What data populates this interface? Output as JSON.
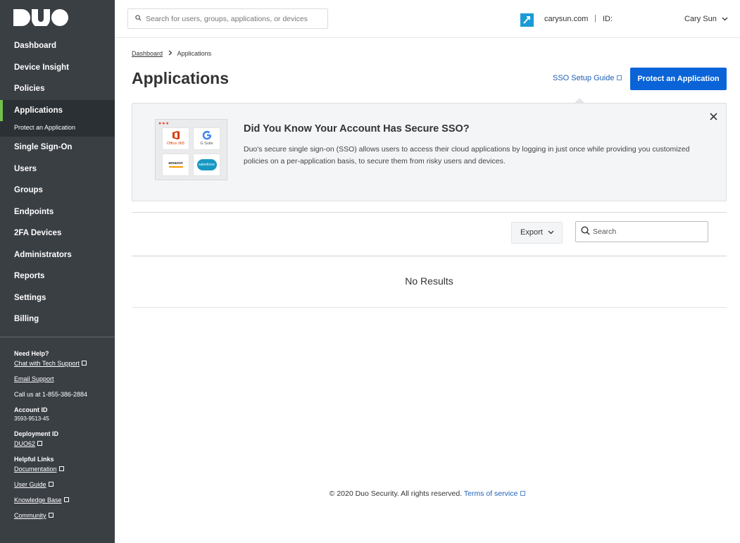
{
  "brand": {
    "logo": "DUO"
  },
  "sidebar": {
    "items": [
      {
        "label": "Dashboard"
      },
      {
        "label": "Device Insight"
      },
      {
        "label": "Policies"
      },
      {
        "label": "Applications"
      },
      {
        "label": "Single Sign-On"
      },
      {
        "label": "Users"
      },
      {
        "label": "Groups"
      },
      {
        "label": "Endpoints"
      },
      {
        "label": "2FA Devices"
      },
      {
        "label": "Administrators"
      },
      {
        "label": "Reports"
      },
      {
        "label": "Settings"
      },
      {
        "label": "Billing"
      }
    ],
    "active_subitem": "Protect an Application",
    "help": {
      "need_help": "Need Help?",
      "chat": "Chat with Tech Support",
      "email": "Email Support",
      "call": "Call us at 1-855-386-2884",
      "account_id_label": "Account ID",
      "account_id": "3593-9513-45",
      "deployment_id_label": "Deployment ID",
      "deployment_id": "DUO62",
      "helpful_links": "Helpful Links",
      "documentation": "Documentation",
      "user_guide": "User Guide",
      "knowledge_base": "Knowledge Base",
      "community": "Community"
    }
  },
  "topbar": {
    "search_placeholder": "Search for users, groups, applications, or devices",
    "org_name": "carysun.com",
    "separator": "|",
    "id_label": "ID:",
    "user_name": "Cary Sun"
  },
  "breadcrumb": {
    "home": "Dashboard",
    "current": "Applications"
  },
  "page": {
    "title": "Applications",
    "sso_guide": "SSO Setup Guide",
    "protect_button": "Protect an Application"
  },
  "banner": {
    "title": "Did You Know Your Account Has Secure SSO?",
    "text": "Duo's secure single sign-on (SSO) allows users to access their cloud applications by logging in just once while providing you customized policies on a per-application basis, to secure them from risky users and devices.",
    "tiles": [
      "Office 365",
      "G Suite",
      "amazon",
      "salesforce"
    ]
  },
  "table": {
    "export_label": "Export",
    "search_placeholder": "Search",
    "empty_text": "No Results"
  },
  "footer": {
    "copyright": "© 2020 Duo Security. All rights reserved.",
    "terms": "Terms of service"
  },
  "colors": {
    "sidebar_bg": "#3a3f44",
    "accent_green": "#6fc04c",
    "primary_blue": "#0a64d8",
    "link_blue": "#1f5fb4"
  }
}
